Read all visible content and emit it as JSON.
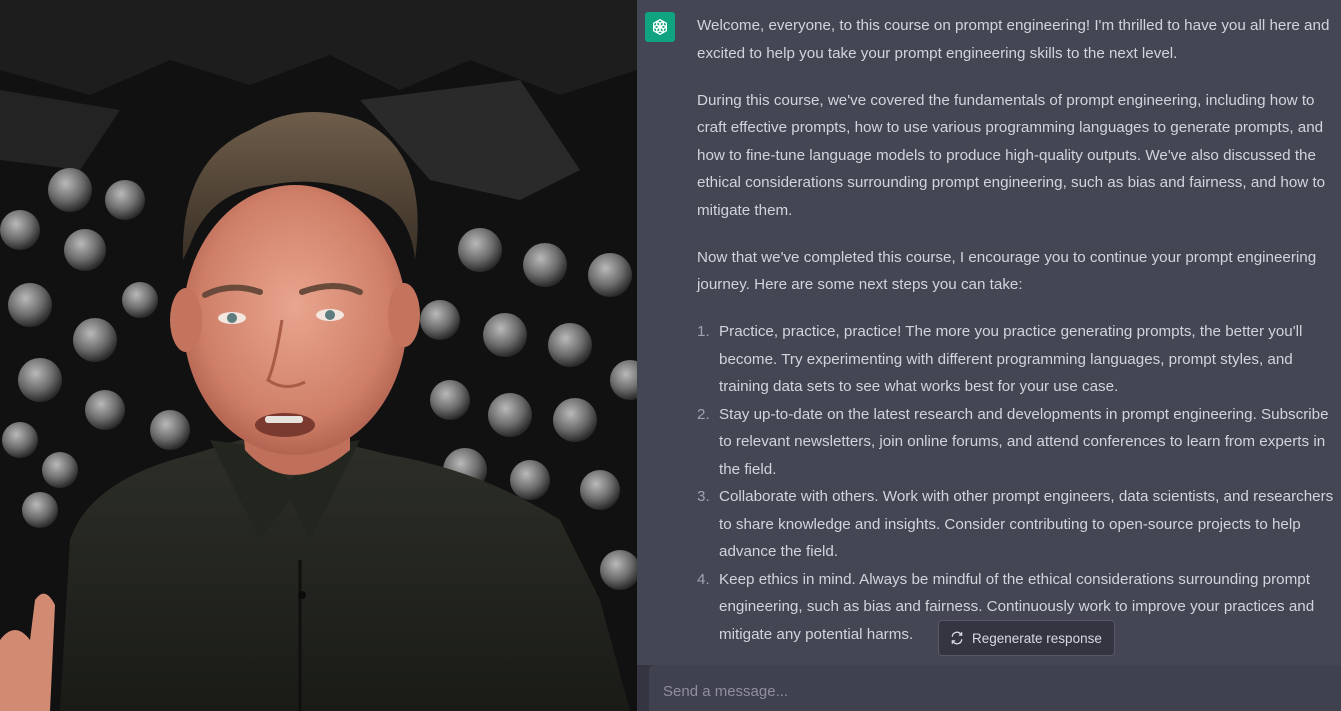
{
  "chat": {
    "assistant_avatar_icon": "openai-logo-icon",
    "paragraphs": [
      "Welcome, everyone, to this course on prompt engineering! I'm thrilled to have you all here and excited to help you take your prompt engineering skills to the next level.",
      "During this course, we've covered the fundamentals of prompt engineering, including how to craft effective prompts, how to use various programming languages to generate prompts, and how to fine-tune language models to produce high-quality outputs. We've also discussed the ethical considerations surrounding prompt engineering, such as bias and fairness, and how to mitigate them.",
      "Now that we've completed this course, I encourage you to continue your prompt engineering journey. Here are some next steps you can take:"
    ],
    "steps": [
      {
        "num": "1.",
        "text": "Practice, practice, practice! The more you practice generating prompts, the better you'll become. Try experimenting with different programming languages, prompt styles, and training data sets to see what works best for your use case."
      },
      {
        "num": "2.",
        "text": "Stay up-to-date on the latest research and developments in prompt engineering. Subscribe to relevant newsletters, join online forums, and attend conferences to learn from experts in the field."
      },
      {
        "num": "3.",
        "text": "Collaborate with others. Work with other prompt engineers, data scientists, and researchers to share knowledge and insights. Consider contributing to open-source projects to help advance the field."
      },
      {
        "num": "4.",
        "text": "Keep ethics in mind. Always be mindful of the ethical considerations surrounding prompt engineering, such as bias and fairness. Continuously work to improve your practices and mitigate any potential harms."
      }
    ],
    "regenerate_label": "Regenerate response",
    "regenerate_icon": "refresh-icon",
    "input_placeholder": "Send a message...",
    "colors": {
      "panel_bg": "#444654",
      "text": "#d1d5db",
      "brand": "#10a37f",
      "input_bg": "#40414f"
    }
  }
}
